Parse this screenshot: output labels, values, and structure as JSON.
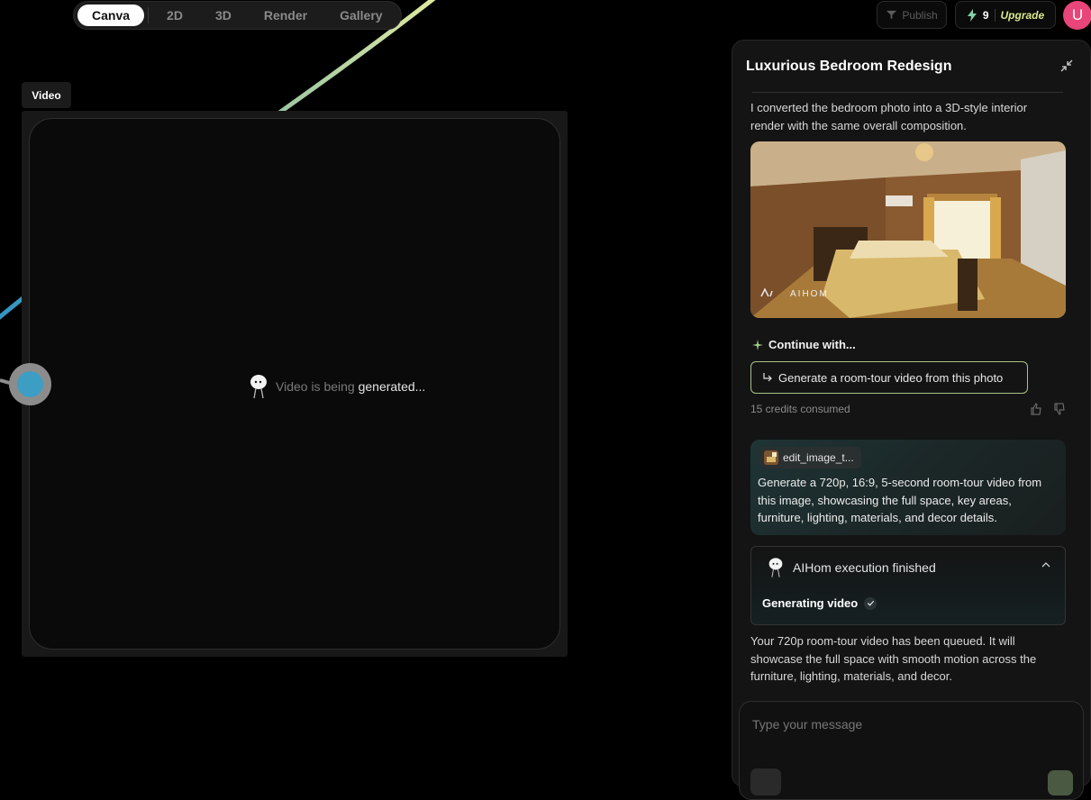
{
  "nav": {
    "tabs": [
      {
        "label": "Canva",
        "active": true
      },
      {
        "label": "2D"
      },
      {
        "label": "3D"
      },
      {
        "label": "Render"
      },
      {
        "label": "Gallery"
      }
    ]
  },
  "topbar": {
    "publish_label": "Publish",
    "credits_count": "9",
    "upgrade_label": "Upgrade",
    "avatar_initial": "U",
    "avatar_color": "#e8457a",
    "accent_upgrade": "#d6e88a"
  },
  "node": {
    "label": "Video",
    "status_prefix": "Video is being",
    "status_suffix": "generated..."
  },
  "chat": {
    "title": "Luxurious Bedroom Redesign",
    "assistant_intro": "I converted the bedroom photo into a 3D-style interior render with the same overall composition.",
    "image_watermark": "AIHOM",
    "continue_label": "Continue with...",
    "suggestion": "Generate a room-tour video from this photo",
    "credits_consumed": "15 credits consumed",
    "user_attachment": "edit_image_t...",
    "user_message": "Generate a 720p, 16:9, 5-second room-tour video from this image, showcasing the full space, key areas, furniture, lighting, materials, and decor details.",
    "exec_title": "AIHom execution finished",
    "exec_step": "Generating video",
    "assistant_reply": "Your 720p room-tour video has been queued. It will showcase the full space with smooth motion across the furniture, lighting, materials, and decor.",
    "composer_placeholder": "Type your message"
  }
}
